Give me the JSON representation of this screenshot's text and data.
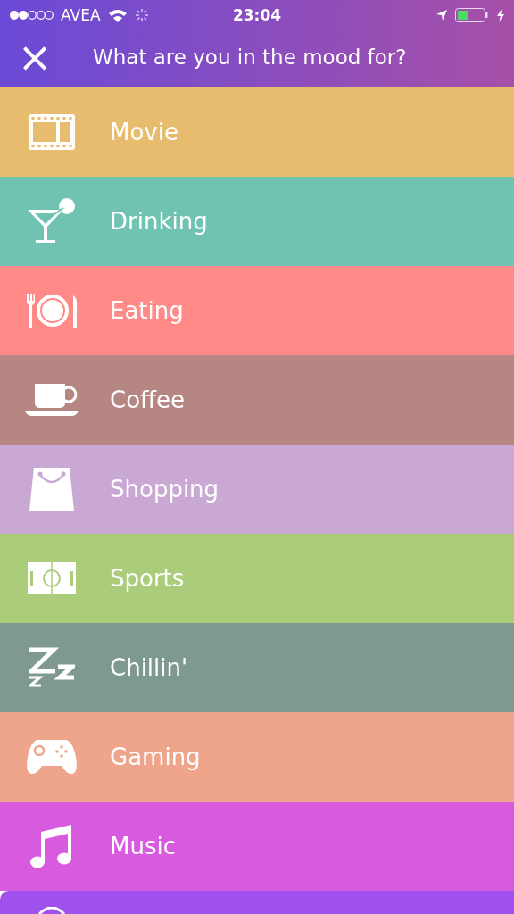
{
  "status_bar": {
    "carrier": "AVEA",
    "time": "23:04"
  },
  "header": {
    "close": "×",
    "title": "What are you in the mood for?"
  },
  "moods": [
    {
      "kind": "movie",
      "label": "Movie",
      "color": "#e8bc6e"
    },
    {
      "kind": "drinking",
      "label": "Drinking",
      "color": "#6fc3b0"
    },
    {
      "kind": "eating",
      "label": "Eating",
      "color": "#ff8a88"
    },
    {
      "kind": "coffee",
      "label": "Coffee",
      "color": "#b58682"
    },
    {
      "kind": "shopping",
      "label": "Shopping",
      "color": "#c9a8d4"
    },
    {
      "kind": "sports",
      "label": "Sports",
      "color": "#abcc7b"
    },
    {
      "kind": "chillin",
      "label": "Chillin'",
      "color": "#7e9990"
    },
    {
      "kind": "gaming",
      "label": "Gaming",
      "color": "#eea58b"
    },
    {
      "kind": "music",
      "label": "Music",
      "color": "#d85ade"
    },
    {
      "kind": "partial",
      "color": "#a050ec"
    }
  ]
}
